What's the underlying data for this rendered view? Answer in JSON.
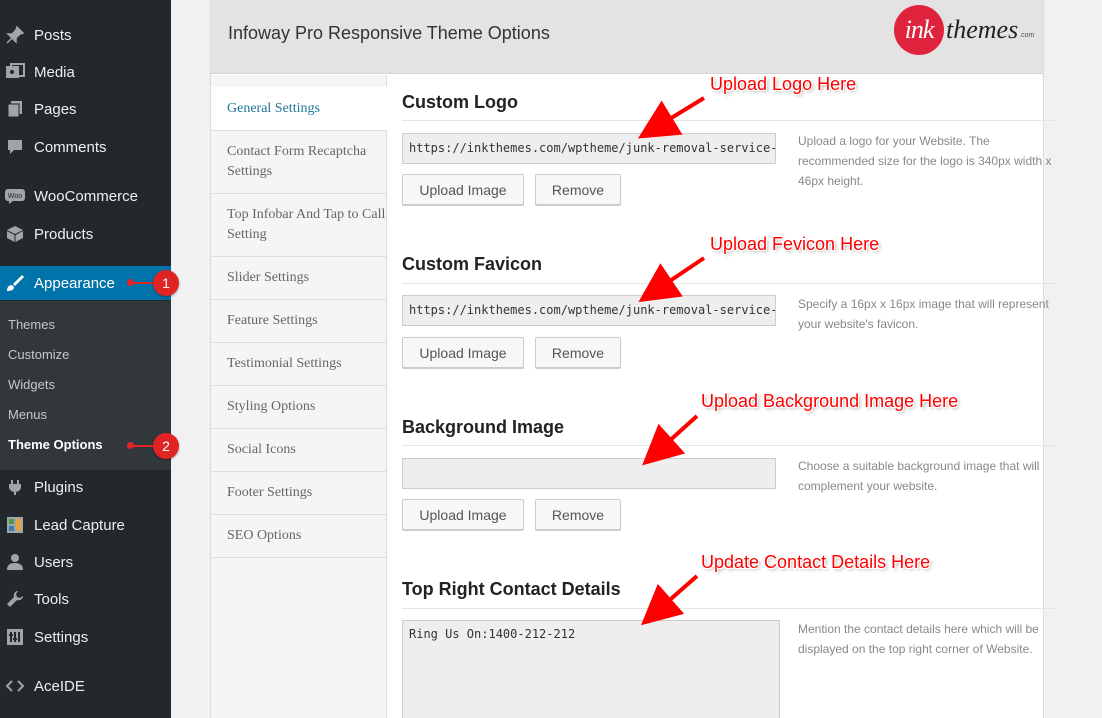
{
  "sidebar": {
    "items": [
      {
        "label": "Posts",
        "icon": "pushpin-icon"
      },
      {
        "label": "Media",
        "icon": "media-icon"
      },
      {
        "label": "Pages",
        "icon": "pages-icon"
      },
      {
        "label": "Comments",
        "icon": "comment-icon"
      },
      {
        "label": "WooCommerce",
        "icon": "woocommerce-icon"
      },
      {
        "label": "Products",
        "icon": "products-icon"
      },
      {
        "label": "Appearance",
        "icon": "brush-icon"
      },
      {
        "label": "Plugins",
        "icon": "plug-icon"
      },
      {
        "label": "Lead Capture",
        "icon": "lead-capture-icon"
      },
      {
        "label": "Users",
        "icon": "user-icon"
      },
      {
        "label": "Tools",
        "icon": "wrench-icon"
      },
      {
        "label": "Settings",
        "icon": "settings-icon"
      },
      {
        "label": "AceIDE",
        "icon": "code-icon"
      }
    ],
    "submenu": [
      "Themes",
      "Customize",
      "Widgets",
      "Menus",
      "Theme Options"
    ],
    "active_color": "#0073aa"
  },
  "panel": {
    "title": "Infoway Pro Responsive Theme Options",
    "logo": {
      "mark": "ink",
      "text": "themes",
      "suffix": ".com",
      "color": "#e0233c"
    }
  },
  "tabs": [
    "General Settings",
    "Contact Form Recaptcha Settings",
    "Top Infobar And Tap to Call Setting",
    "Slider Settings",
    "Feature Settings",
    "Testimonial Settings",
    "Styling Options",
    "Social Icons",
    "Footer Settings",
    "SEO Options"
  ],
  "sections": {
    "logo": {
      "title": "Custom Logo",
      "value": "https://inkthemes.com/wptheme/junk-removal-service-",
      "help": "Upload a logo for your Website. The recommended size for the logo is 340px width x 46px height."
    },
    "favicon": {
      "title": "Custom Favicon",
      "value": "https://inkthemes.com/wptheme/junk-removal-service-",
      "help": "Specify a 16px x 16px image that will represent your website's favicon."
    },
    "background": {
      "title": "Background Image",
      "value": "",
      "help": "Choose a suitable background image that will complement your website."
    },
    "contact": {
      "title": "Top Right Contact Details",
      "value": "Ring Us On:1400-212-212",
      "help": "Mention the contact details here which will be displayed on the top right corner of Website."
    }
  },
  "buttons": {
    "upload": "Upload Image",
    "remove": "Remove"
  },
  "annotations": {
    "logo": "Upload Logo Here",
    "favicon": "Upload Fevicon Here",
    "background": "Upload Background Image Here",
    "contact": "Update Contact Details Here",
    "badge1": "1",
    "badge2": "2",
    "color": "#ff0000"
  }
}
